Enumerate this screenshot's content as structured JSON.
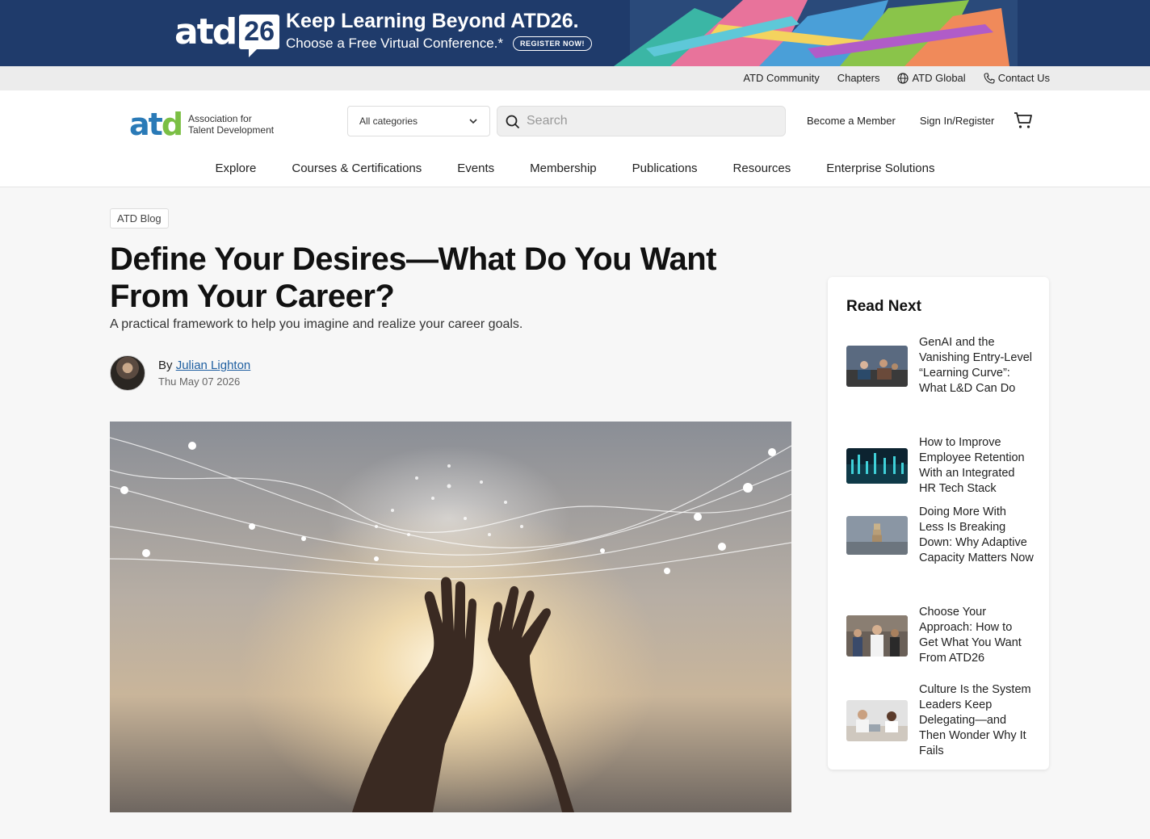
{
  "banner": {
    "logo_atd": "atd",
    "logo_year": "26",
    "headline": "Keep Learning Beyond ATD26.",
    "subline": "Choose a Free Virtual Conference.*",
    "cta": "REGISTER NOW!"
  },
  "utility_nav": {
    "items": [
      {
        "label": "ATD Community",
        "icon": ""
      },
      {
        "label": "Chapters",
        "icon": ""
      },
      {
        "label": "ATD Global",
        "icon": "globe-icon"
      },
      {
        "label": "Contact Us",
        "icon": "phone-icon"
      }
    ]
  },
  "header": {
    "logo_mark": "atd",
    "logo_line1": "Association for",
    "logo_line2": "Talent Development",
    "category_select": "All categories",
    "search_placeholder": "Search",
    "become_member": "Become a Member",
    "sign_in": "Sign In/Register"
  },
  "main_nav": [
    "Explore",
    "Courses & Certifications",
    "Events",
    "Membership",
    "Publications",
    "Resources",
    "Enterprise Solutions"
  ],
  "article": {
    "tag": "ATD Blog",
    "title": "Define Your Desires—What Do You Want From Your Career?",
    "subtitle": "A practical framework to help you imagine and realize your career goals.",
    "by": "By",
    "author": "Julian Lighton",
    "date": "Thu May 07 2026"
  },
  "read_next": {
    "heading": "Read Next",
    "items": [
      {
        "title": "GenAI and the Vanishing Entry-Level “Learning Curve”: What L&D Can Do"
      },
      {
        "title": "How to Improve Employee Retention With an Integrated HR Tech Stack"
      },
      {
        "title": "Doing More With Less Is Breaking Down: Why Adaptive Capacity Matters Now"
      },
      {
        "title": "Choose Your Approach: How to Get What You Want From ATD26"
      },
      {
        "title": "Culture Is the System Leaders Keep Delegating—and Then Wonder Why It Fails"
      }
    ]
  },
  "colors": {
    "banner_bg": "#1f3b6b",
    "link": "#1f5fa0",
    "logo_blue": "#2a7ab7",
    "logo_green": "#7bbf44"
  }
}
